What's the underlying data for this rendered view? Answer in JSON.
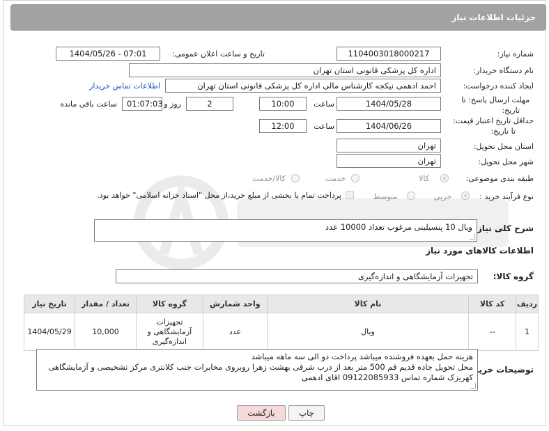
{
  "header": {
    "title": "جزئیات اطلاعات نیاز"
  },
  "fields": {
    "need_number_label": "شماره نیاز:",
    "need_number": "1104003018000217",
    "announce_label": "تاریخ و ساعت اعلان عمومی:",
    "announce_value": "1404/05/26 - 07:01",
    "buyer_org_label": "نام دستگاه خریدار:",
    "buyer_org": "اداره کل پزشکی قانونی استان تهران",
    "requester_label": "ایجاد کننده درخواست:",
    "requester": "احمد ادهمی نیکجه کارشناس مالی اداره کل پزشکی قانونی استان تهران",
    "contact_link": "اطلاعات تماس خریدار",
    "deadline_label_1": "مهلت ارسال پاسخ: تا",
    "deadline_label_2": "تاریخ:",
    "deadline_date": "1404/05/28",
    "time_label": "ساعت",
    "deadline_time": "10:00",
    "days_value": "2",
    "days_label": "روز و",
    "remaining_time": "01:07:03",
    "remaining_label": "ساعت باقی مانده",
    "price_validity_label_1": "حداقل تاریخ اعتبار قیمت:",
    "price_validity_label_2": "تا تاریخ:",
    "price_validity_date": "1404/06/26",
    "price_validity_time": "12:00",
    "province_label": "استان محل تحویل:",
    "province": "تهران",
    "city_label": "شهر محل تحویل:",
    "city": "تهران",
    "category_label": "طبقه بندی موضوعی:",
    "category_options": [
      "کالا",
      "خدمت",
      "کالا/خدمت"
    ],
    "process_label": "نوع فرآیند خرید :",
    "process_options": [
      "جزیی",
      "متوسط"
    ],
    "payment_note": "پرداخت تمام یا بخشی از مبلغ خرید،از محل \"اسناد خزانه اسلامی\" خواهد بود."
  },
  "description": {
    "label": "شرح کلی نیاز:",
    "text": "ویال 10 پنسیلینی مرغوب تعداد 10000 عدد"
  },
  "goods": {
    "section_title": "اطلاعات کالاهای مورد نیاز",
    "group_label": "گروه کالا:",
    "group_value": "تجهیزات آزمایشگاهی و اندازه‌گیری"
  },
  "table": {
    "headers": [
      "ردیف",
      "کد کالا",
      "نام کالا",
      "واحد شمارش",
      "گروه کالا",
      "تعداد / مقدار",
      "تاریخ نیاز"
    ],
    "rows": [
      {
        "row": "1",
        "code": "--",
        "name": "ویال",
        "unit": "عدد",
        "group": "تجهیزات آزمایشگاهی و اندازه‌گیری",
        "qty": "10,000",
        "date": "1404/05/29"
      }
    ]
  },
  "buyer_notes": {
    "label": "توضیحات خریدار:",
    "line1": "هزینه حمل بعهده فروشنده میباشد پرداخت دو الی سه ماهه میباشد",
    "line2": "محل تحویل جاده قدیم قم 500 متر بعد از درب شرقی بهشت زهرا روبروی مخابرات جنب کلانتری مرکز تشخیصی و آزمایشگاهی کهریزک شماره تماس 09122085933 اقای ادهمی"
  },
  "buttons": {
    "print": "چاپ",
    "back": "بازگشت"
  },
  "colors": {
    "header_bg": "#a2a2a2",
    "link": "#1a56c8",
    "back_button_bg": "#f6d9d9"
  }
}
